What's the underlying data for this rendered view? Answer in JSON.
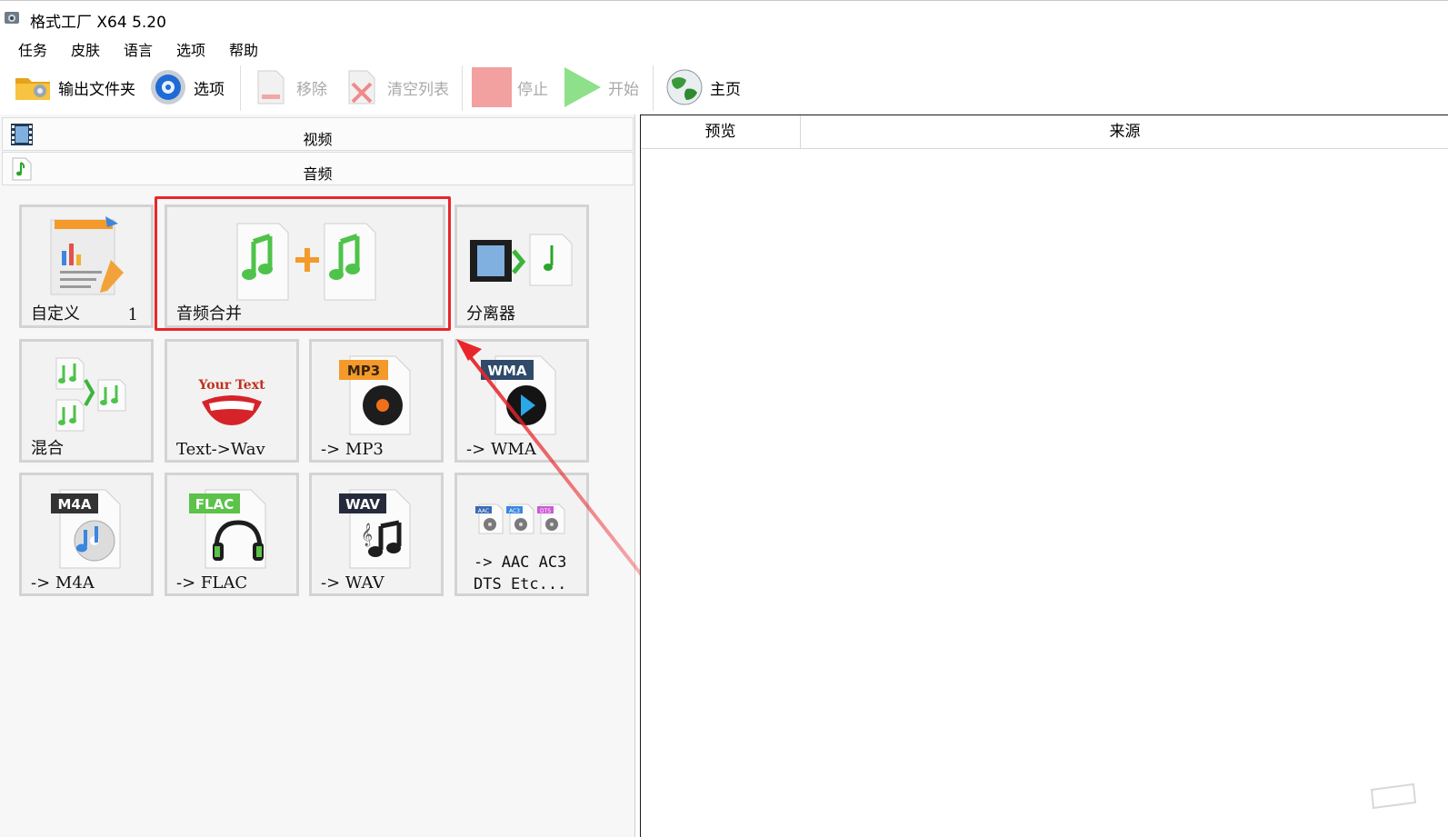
{
  "window": {
    "title": "格式工厂 X64 5.20"
  },
  "menu": [
    "任务",
    "皮肤",
    "语言",
    "选项",
    "帮助"
  ],
  "toolbar": {
    "output_folder": "输出文件夹",
    "options": "选项",
    "remove": "移除",
    "clear_list": "清空列表",
    "stop": "停止",
    "start": "开始",
    "home": "主页"
  },
  "categories": {
    "video": "视频",
    "audio": "音频"
  },
  "tiles": {
    "custom": {
      "label": "自定义",
      "badge": "1"
    },
    "audio_merge": {
      "label": "音频合并"
    },
    "splitter": {
      "label": "分离器"
    },
    "mix": {
      "label": "混合"
    },
    "text_wav": {
      "label": "Text->Wav",
      "icon_text": "Your Text"
    },
    "mp3": {
      "label": "-> MP3",
      "badge": "MP3"
    },
    "wma": {
      "label": "-> WMA",
      "badge": "WMA"
    },
    "m4a": {
      "label": "-> M4A",
      "badge": "M4A"
    },
    "flac": {
      "label": "-> FLAC",
      "badge": "FLAC"
    },
    "wav": {
      "label": "-> WAV",
      "badge": "WAV"
    },
    "aac": {
      "line1": "-> AAC AC3",
      "line2": "DTS Etc...",
      "mini_badges": [
        "AAC",
        "AC3",
        "DTS"
      ]
    }
  },
  "right_panel": {
    "col_preview": "预览",
    "col_source": "来源"
  },
  "colors": {
    "highlight": "#e8262a",
    "accent_green": "#5fd35a",
    "stop_red": "#f2a0a0"
  }
}
